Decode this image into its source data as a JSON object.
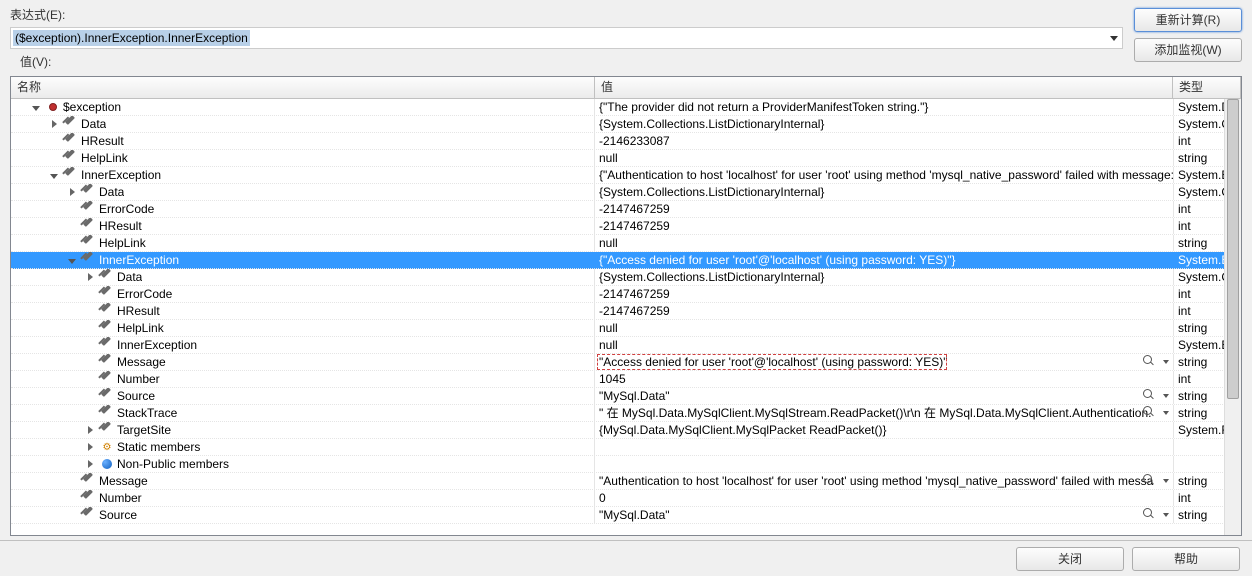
{
  "labels": {
    "expression": "表达式(E):",
    "value": "值(V):",
    "recalc": "重新计算(R)",
    "addwatch": "添加监视(W)",
    "close": "关闭",
    "help": "帮助"
  },
  "expression_text": "($exception).InnerException.InnerException",
  "columns": {
    "name": "名称",
    "value": "值",
    "type": "类型"
  },
  "rows": [
    {
      "depth": 0,
      "expander": "open",
      "icon": "bullet",
      "name": "$exception",
      "value": "{\"The provider did not return a ProviderManifestToken string.\"}",
      "type": "System.D"
    },
    {
      "depth": 1,
      "expander": "closed",
      "icon": "wrench",
      "name": "Data",
      "value": "{System.Collections.ListDictionaryInternal}",
      "type": "System.C"
    },
    {
      "depth": 1,
      "expander": "none",
      "icon": "wrench",
      "name": "HResult",
      "value": "-2146233087",
      "type": "int"
    },
    {
      "depth": 1,
      "expander": "none",
      "icon": "wrench",
      "name": "HelpLink",
      "value": "null",
      "type": "string"
    },
    {
      "depth": 1,
      "expander": "open",
      "icon": "wrench",
      "name": "InnerException",
      "value": "{\"Authentication to host 'localhost' for user 'root' using method 'mysql_native_password' failed with message: A",
      "type": "System.E"
    },
    {
      "depth": 2,
      "expander": "closed",
      "icon": "wrench",
      "name": "Data",
      "value": "{System.Collections.ListDictionaryInternal}",
      "type": "System.C"
    },
    {
      "depth": 2,
      "expander": "none",
      "icon": "wrench",
      "name": "ErrorCode",
      "value": "-2147467259",
      "type": "int"
    },
    {
      "depth": 2,
      "expander": "none",
      "icon": "wrench",
      "name": "HResult",
      "value": "-2147467259",
      "type": "int"
    },
    {
      "depth": 2,
      "expander": "none",
      "icon": "wrench",
      "name": "HelpLink",
      "value": "null",
      "type": "string"
    },
    {
      "depth": 2,
      "expander": "open",
      "icon": "wrench",
      "name": "InnerException",
      "value": "{\"Access denied for user 'root'@'localhost' (using password: YES)\"}",
      "type": "System.E",
      "selected": true
    },
    {
      "depth": 3,
      "expander": "closed",
      "icon": "wrench",
      "name": "Data",
      "value": "{System.Collections.ListDictionaryInternal}",
      "type": "System.C"
    },
    {
      "depth": 3,
      "expander": "none",
      "icon": "wrench",
      "name": "ErrorCode",
      "value": "-2147467259",
      "type": "int"
    },
    {
      "depth": 3,
      "expander": "none",
      "icon": "wrench",
      "name": "HResult",
      "value": "-2147467259",
      "type": "int"
    },
    {
      "depth": 3,
      "expander": "none",
      "icon": "wrench",
      "name": "HelpLink",
      "value": "null",
      "type": "string"
    },
    {
      "depth": 3,
      "expander": "none",
      "icon": "wrench",
      "name": "InnerException",
      "value": "null",
      "type": "System.E"
    },
    {
      "depth": 3,
      "expander": "none",
      "icon": "wrench",
      "name": "Message",
      "value": "\"Access denied for user 'root'@'localhost' (using password: YES)\"",
      "type": "string",
      "mag": true,
      "highlight": true
    },
    {
      "depth": 3,
      "expander": "none",
      "icon": "wrench",
      "name": "Number",
      "value": "1045",
      "type": "int"
    },
    {
      "depth": 3,
      "expander": "none",
      "icon": "wrench",
      "name": "Source",
      "value": "\"MySql.Data\"",
      "type": "string",
      "mag": true
    },
    {
      "depth": 3,
      "expander": "none",
      "icon": "wrench",
      "name": "StackTrace",
      "value": "\"   在 MySql.Data.MySqlClient.MySqlStream.ReadPacket()\\r\\n   在 MySql.Data.MySqlClient.Authentication.",
      "type": "string",
      "mag": true
    },
    {
      "depth": 3,
      "expander": "closed",
      "icon": "wrench",
      "name": "TargetSite",
      "value": "{MySql.Data.MySqlClient.MySqlPacket ReadPacket()}",
      "type": "System.R"
    },
    {
      "depth": 3,
      "expander": "closed",
      "icon": "static",
      "name": "Static members",
      "value": "",
      "type": ""
    },
    {
      "depth": 3,
      "expander": "closed",
      "icon": "nonpub",
      "name": "Non-Public members",
      "value": "",
      "type": ""
    },
    {
      "depth": 2,
      "expander": "none",
      "icon": "wrench",
      "name": "Message",
      "value": "\"Authentication to host 'localhost' for user 'root' using method 'mysql_native_password' failed with messa",
      "type": "string",
      "mag": true
    },
    {
      "depth": 2,
      "expander": "none",
      "icon": "wrench",
      "name": "Number",
      "value": "0",
      "type": "int"
    },
    {
      "depth": 2,
      "expander": "none",
      "icon": "wrench",
      "name": "Source",
      "value": "\"MySql.Data\"",
      "type": "string",
      "mag": true
    }
  ]
}
